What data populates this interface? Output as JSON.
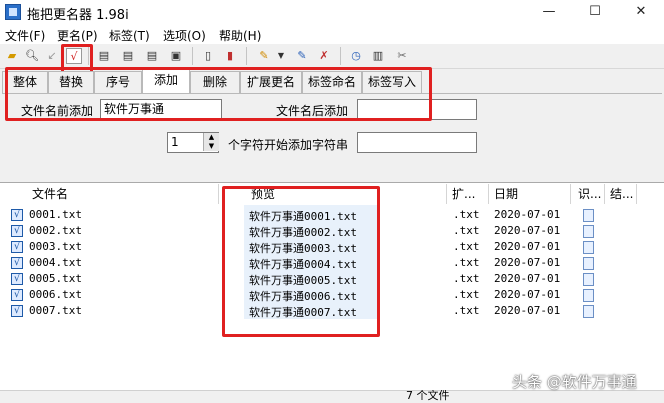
{
  "window": {
    "title": "拖把更名器 1.98i",
    "minimize": "—",
    "maximize": "☐",
    "close": "✕"
  },
  "menu": [
    "文件(F)",
    "更名(P)",
    "标签(T)",
    "选项(O)",
    "帮助(H)"
  ],
  "tabs": [
    "整体",
    "替换",
    "序号",
    "添加",
    "删除",
    "扩展更名",
    "标签命名",
    "标签写入"
  ],
  "active_tab": "添加",
  "form": {
    "prefix_label": "文件名前添加",
    "prefix_value": "软件万事通",
    "suffix_label": "文件名后添加",
    "suffix_value": "",
    "position_value": "1",
    "position_label": "个字符开始添加字符串",
    "insert_value": ""
  },
  "list": {
    "headers": [
      "文件名",
      "预览",
      "扩...",
      "日期",
      "识...",
      "结..."
    ],
    "rows": [
      {
        "name": "0001.txt",
        "preview": "软件万事通0001.txt",
        "ext": ".txt",
        "date": "2020-07-01"
      },
      {
        "name": "0002.txt",
        "preview": "软件万事通0002.txt",
        "ext": ".txt",
        "date": "2020-07-01"
      },
      {
        "name": "0003.txt",
        "preview": "软件万事通0003.txt",
        "ext": ".txt",
        "date": "2020-07-01"
      },
      {
        "name": "0004.txt",
        "preview": "软件万事通0004.txt",
        "ext": ".txt",
        "date": "2020-07-01"
      },
      {
        "name": "0005.txt",
        "preview": "软件万事通0005.txt",
        "ext": ".txt",
        "date": "2020-07-01"
      },
      {
        "name": "0006.txt",
        "preview": "软件万事通0006.txt",
        "ext": ".txt",
        "date": "2020-07-01"
      },
      {
        "name": "0007.txt",
        "preview": "软件万事通0007.txt",
        "ext": ".txt",
        "date": "2020-07-01"
      }
    ]
  },
  "status": "7 个文件",
  "watermark": "头条 @软件万事通",
  "toolbar_icons": [
    "folder-open-icon",
    "search-icon",
    "arrow-icon",
    "checkmark-icon",
    "rename-icon-1",
    "rename-icon-2",
    "rename-icon-3",
    "rename-icon-4",
    "document-icon",
    "document-edit-icon",
    "pencil-icon",
    "dropdown-icon",
    "pen-icon",
    "pen-delete-icon",
    "clock-icon",
    "window-icon",
    "tools-icon"
  ],
  "colors": {
    "highlight": "#e02020",
    "accent": "#1e5aa8"
  }
}
